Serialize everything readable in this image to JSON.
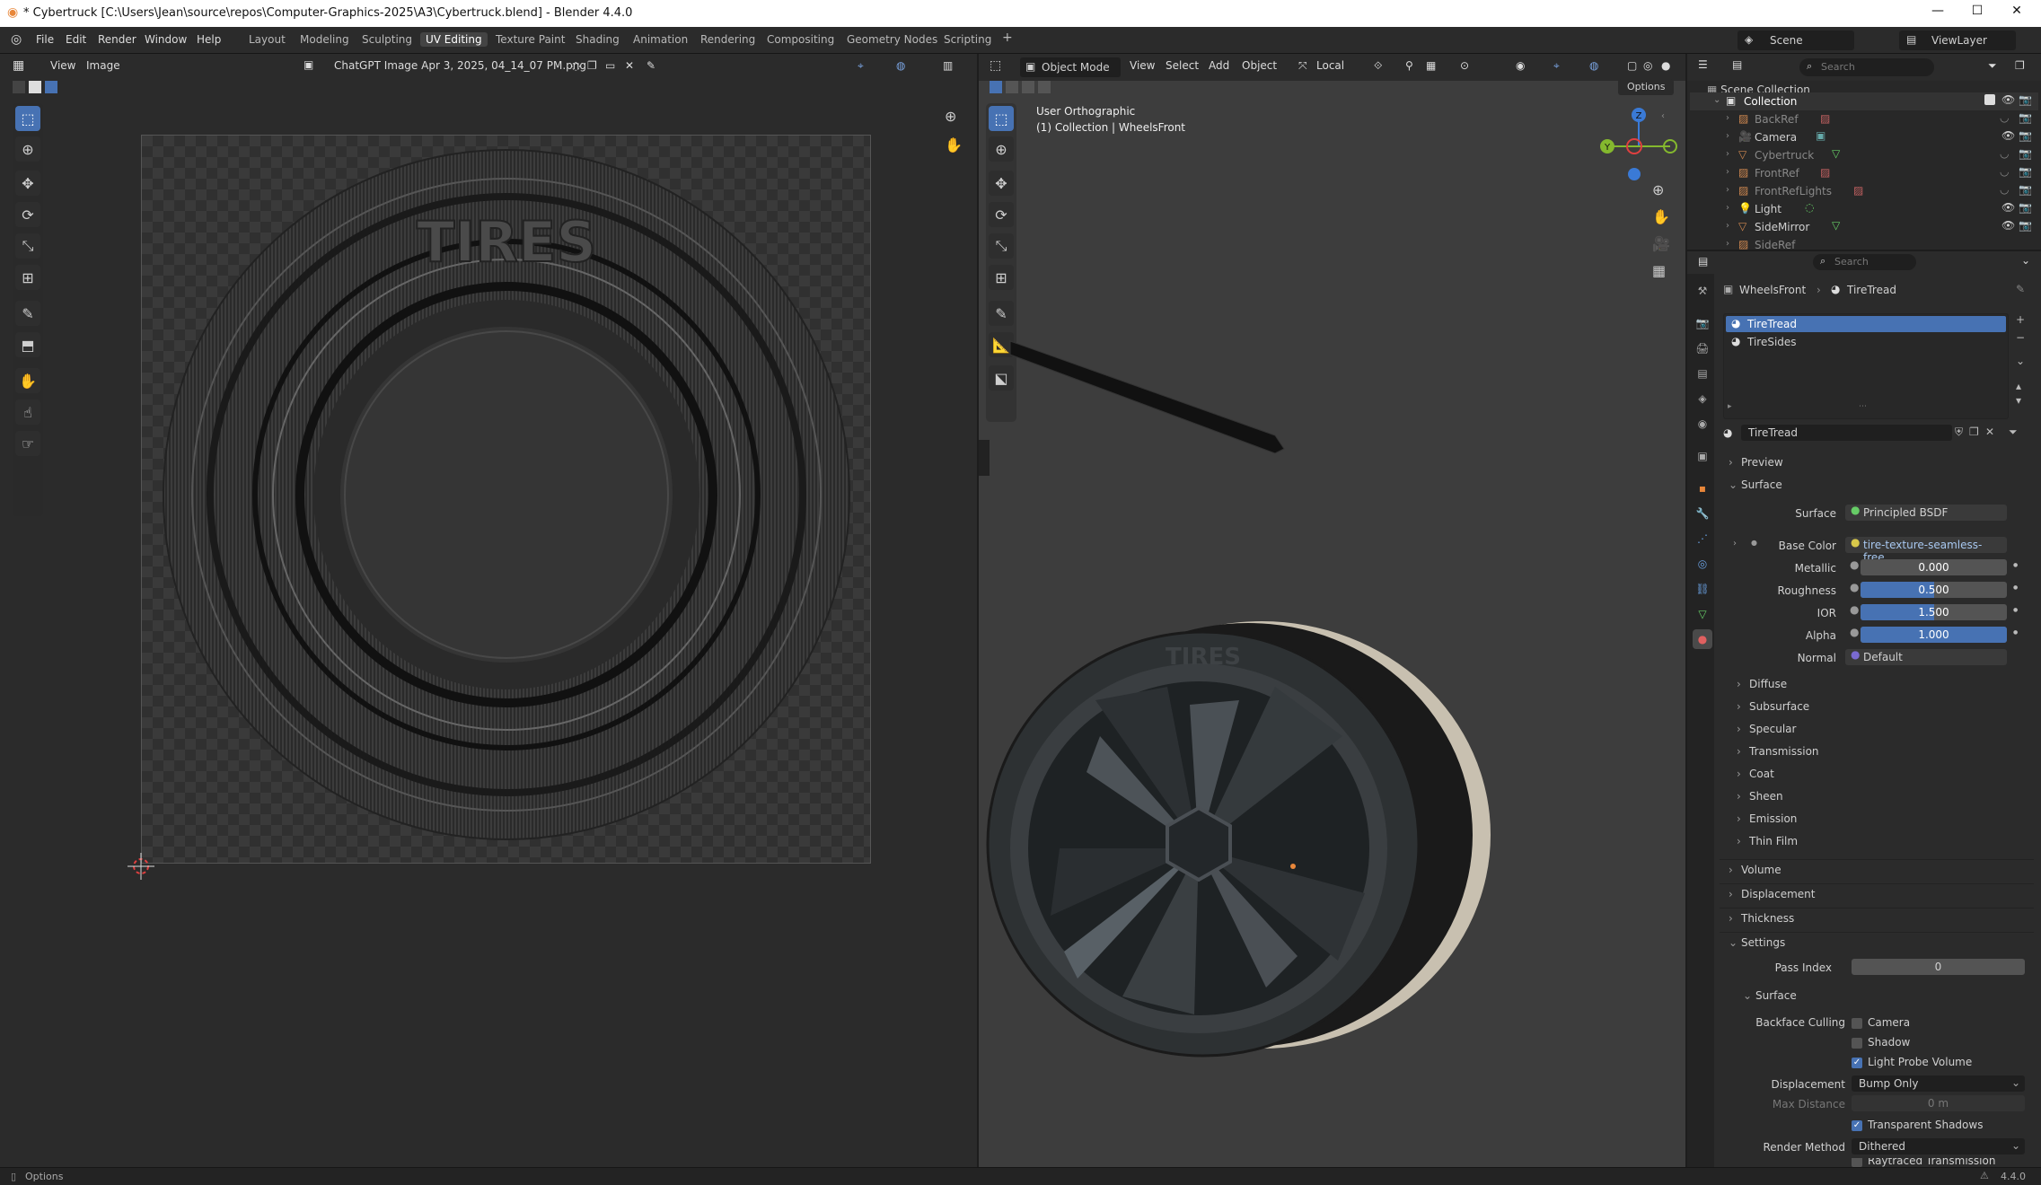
{
  "window": {
    "title": "* Cybertruck [C:\\Users\\Jean\\source\\repos\\Computer-Graphics-2025\\A3\\Cybertruck.blend] - Blender 4.4.0",
    "minimize": "—",
    "maximize": "☐",
    "close": "✕"
  },
  "menus": [
    "File",
    "Edit",
    "Render",
    "Window",
    "Help"
  ],
  "workspaces": [
    "Layout",
    "Modeling",
    "Sculpting",
    "UV Editing",
    "Texture Paint",
    "Shading",
    "Animation",
    "Rendering",
    "Compositing",
    "Geometry Nodes",
    "Scripting"
  ],
  "workspace_add": "+",
  "scene": {
    "label": "Scene",
    "viewlayer": "ViewLayer"
  },
  "uv_editor": {
    "view": "View",
    "image": "Image",
    "image_name": "ChatGPT Image Apr 3, 2025, 04_14_07 PM.png",
    "tire_text": "TIRES"
  },
  "viewport": {
    "mode": "Object Mode",
    "menus": [
      "View",
      "Select",
      "Add",
      "Object"
    ],
    "orientation": "Local",
    "options": "Options",
    "view_name": "User Orthographic",
    "collection_path": "(1) Collection | WheelsFront",
    "tire_text": "TIRES",
    "gizmo": {
      "x": "X",
      "y": "Y",
      "z": "Z"
    }
  },
  "outliner": {
    "search_placeholder": "Search",
    "root": "Scene Collection",
    "collection": "Collection",
    "items": [
      "BackRef",
      "Camera",
      "Cybertruck",
      "FrontRef",
      "FrontRefLights",
      "Light",
      "SideMirror",
      "SideRef"
    ]
  },
  "properties": {
    "search_placeholder": "Search",
    "breadcrumb": [
      "WheelsFront",
      "TireTread"
    ],
    "slots": [
      "TireTread",
      "TireSides"
    ],
    "material_name": "TireTread",
    "panels": {
      "preview": "Preview",
      "surface": "Surface",
      "volume": "Volume",
      "displacement": "Displacement",
      "thickness": "Thickness",
      "settings": "Settings"
    },
    "surface_label": "Surface",
    "surface_value": "Principled BSDF",
    "inputs": [
      {
        "label": "Base Color",
        "value": "tire-texture-seamless-free...."
      },
      {
        "label": "Metallic",
        "value": "0.000",
        "fill": 0
      },
      {
        "label": "Roughness",
        "value": "0.500",
        "fill": 0.5
      },
      {
        "label": "IOR",
        "value": "1.500",
        "fill": 0.5
      },
      {
        "label": "Alpha",
        "value": "1.000",
        "fill": 1
      },
      {
        "label": "Normal",
        "value": "Default"
      }
    ],
    "subpanels": [
      "Diffuse",
      "Subsurface",
      "Specular",
      "Transmission",
      "Coat",
      "Sheen",
      "Emission",
      "Thin Film"
    ],
    "settings": {
      "pass_index_label": "Pass Index",
      "pass_index": "0",
      "surface_sub": "Surface",
      "backface_label": "Backface Culling",
      "camera": "Camera",
      "shadow": "Shadow",
      "light_probe": "Light Probe Volume",
      "displacement_label": "Displacement",
      "displacement_value": "Bump Only",
      "max_distance_label": "Max Distance",
      "max_distance": "0 m",
      "transparent_shadows": "Transparent Shadows",
      "render_method_label": "Render Method",
      "render_method": "Dithered",
      "raytraced": "Raytraced Transmission"
    }
  },
  "status": {
    "left": "Options",
    "version": "4.4.0"
  },
  "colors": {
    "accent": "#4772b3",
    "orange": "#e8873a",
    "x_axis": "#e04040",
    "y_axis": "#84b82e",
    "z_axis": "#3a7ad6"
  }
}
